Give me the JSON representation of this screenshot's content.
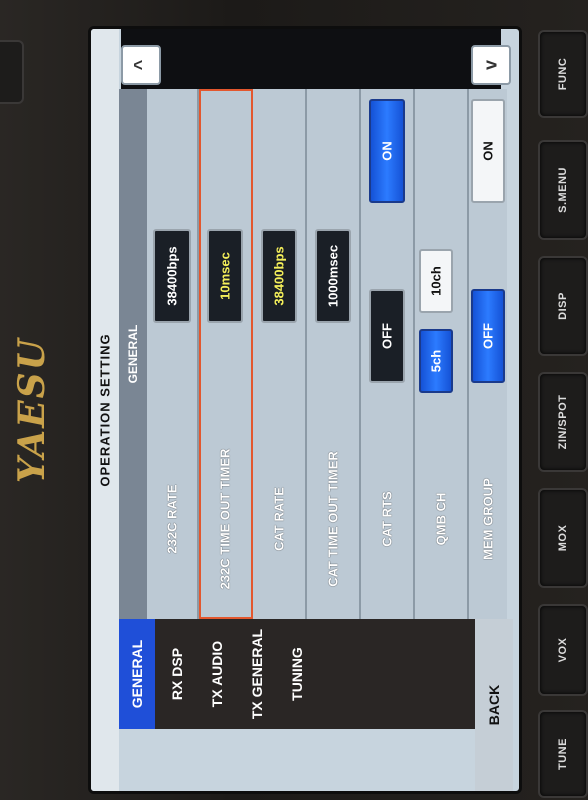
{
  "brand": "YAESU",
  "screen": {
    "title": "OPERATION SETTING",
    "section_tab": "GENERAL",
    "rows": [
      {
        "label": "232C RATE",
        "value": "38400bps"
      },
      {
        "label": "232C TIME OUT TIMER",
        "value": "10msec"
      },
      {
        "label": "CAT RATE",
        "value": "38400bps"
      },
      {
        "label": "CAT TIME OUT TIMER",
        "value": "1000msec"
      },
      {
        "label": "CAT RTS",
        "off": "OFF",
        "on": "ON"
      },
      {
        "label": "QMB CH",
        "opt1": "5ch",
        "opt2": "10ch"
      },
      {
        "label": "MEM GROUP",
        "off": "OFF",
        "on": "ON"
      }
    ],
    "menu": [
      "GENERAL",
      "RX DSP",
      "TX AUDIO",
      "TX GENERAL",
      "TUNING"
    ],
    "back_label": "BACK",
    "scroll_up": "^",
    "scroll_down": "v"
  },
  "hardware_buttons": [
    "FUNC",
    "S.MENU",
    "DISP",
    "ZIN/SPOT",
    "MOX",
    "VOX",
    "TUNE"
  ],
  "colors": {
    "accent_blue": "#1f4fd8",
    "selection_outline": "#e3572e",
    "value_highlight": "#f4ef5a"
  }
}
